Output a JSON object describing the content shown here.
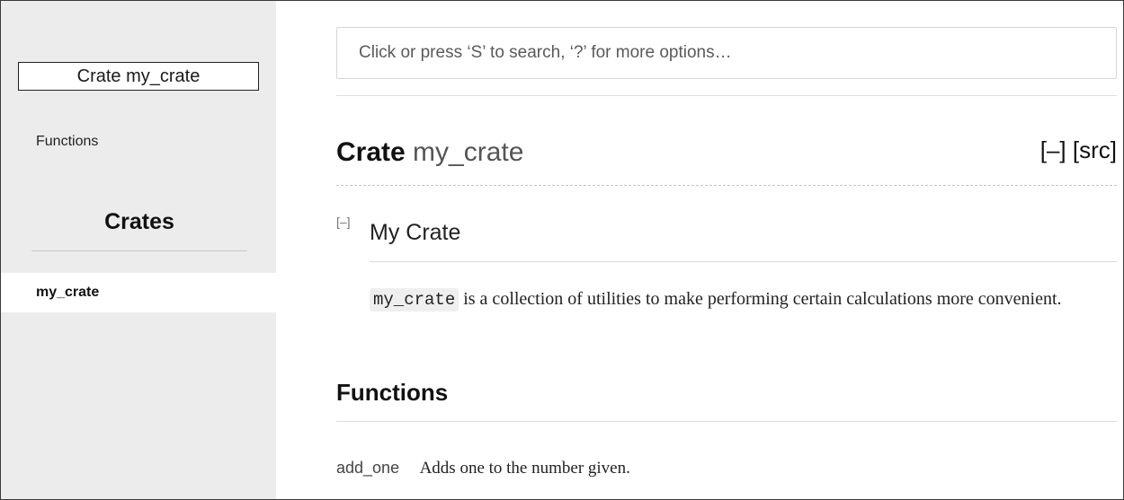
{
  "sidebar": {
    "crate_label": "Crate my_crate",
    "functions_link": "Functions",
    "crates_heading": "Crates",
    "crates": [
      {
        "name": "my_crate",
        "selected": true
      }
    ]
  },
  "search": {
    "placeholder": "Click or press ‘S’ to search, ‘?’ for more options…"
  },
  "main": {
    "title_kind": "Crate",
    "title_name": "my_crate",
    "collapse_all_label": "[–]",
    "src_label": "[src]",
    "doc_toggle": "[–]",
    "doc_heading": "My Crate",
    "doc_code": "my_crate",
    "doc_text_line": "is a collection of utilities to make performing certain calculations more convenient.",
    "functions_heading": "Functions",
    "functions": [
      {
        "name": "add_one",
        "description": "Adds one to the number given."
      }
    ]
  },
  "colors": {
    "sidebar_bg": "#ececec",
    "text": "#111111",
    "muted": "#555555"
  }
}
